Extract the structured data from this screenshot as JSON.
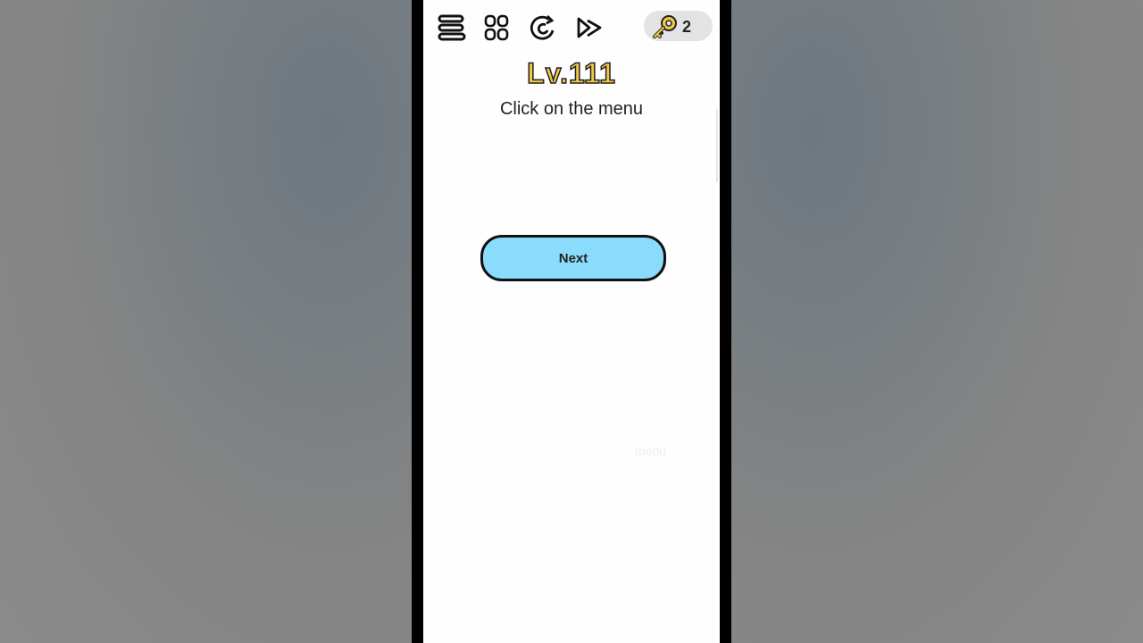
{
  "toolbar": {
    "icons": [
      "menu-icon",
      "levels-grid-icon",
      "restart-icon",
      "skip-icon"
    ],
    "keys_count": "2"
  },
  "level": {
    "title": "Lv.111",
    "instruction": "Click on the menu"
  },
  "next_label": "Next",
  "hidden_menu_label": "menu",
  "colors": {
    "level_title": "#f1c945",
    "next_button": "#89dcfb",
    "key": "#f1c945"
  }
}
